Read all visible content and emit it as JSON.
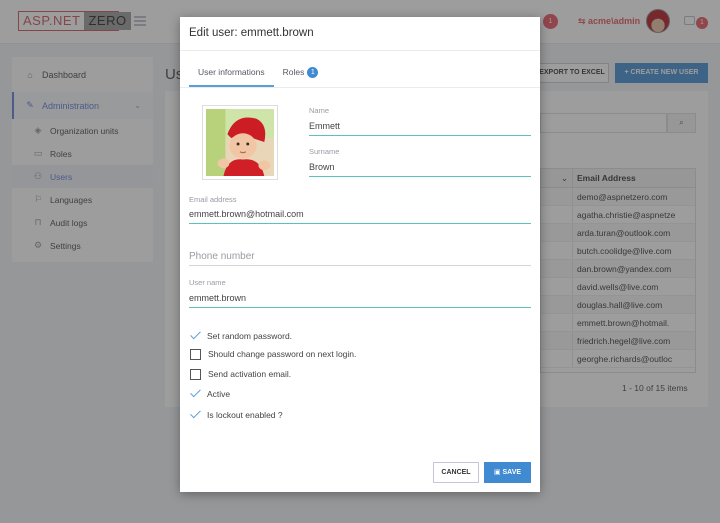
{
  "topbar": {
    "logo_part1": "ASP.NET",
    "logo_part2": "ZERO",
    "notification_count": "1",
    "user_label": "acme\\admin",
    "chat_count": "1"
  },
  "sidebar": {
    "items": [
      {
        "label": "Dashboard",
        "icon": "home-icon"
      },
      {
        "label": "Administration",
        "icon": "wrench-icon"
      },
      {
        "label": "Organization units",
        "icon": "layers-icon"
      },
      {
        "label": "Roles",
        "icon": "briefcase-icon"
      },
      {
        "label": "Users",
        "icon": "users-icon"
      },
      {
        "label": "Languages",
        "icon": "flag-icon"
      },
      {
        "label": "Audit logs",
        "icon": "lock-icon"
      },
      {
        "label": "Settings",
        "icon": "gear-icon"
      }
    ]
  },
  "page": {
    "title": "Us",
    "export_label": "EXPORT TO EXCEL",
    "create_label": "+ CREATE NEW USER",
    "table_header": "Email Address",
    "emails": [
      "demo@aspnetzero.com",
      "agatha.christie@aspnetze",
      "arda.turan@outlook.com",
      "butch.coolidge@live.com",
      "dan.brown@yandex.com",
      "david.wells@live.com",
      "douglas.hall@live.com",
      "emmett.brown@hotmail.",
      "friedrich.hegel@live.com",
      "georghe.richards@outloc"
    ],
    "pager_info": "1 - 10 of 15 items"
  },
  "modal": {
    "title": "Edit user: emmett.brown",
    "tabs": [
      {
        "label": "User informations"
      },
      {
        "label": "Roles",
        "badge": "1"
      }
    ],
    "fields": {
      "name_label": "Name",
      "name_value": "Emmett",
      "surname_label": "Surname",
      "surname_value": "Brown",
      "email_label": "Email address",
      "email_value": "emmett.brown@hotmail.com",
      "phone_placeholder": "Phone number",
      "username_label": "User name",
      "username_value": "emmett.brown"
    },
    "checks": [
      {
        "label": "Set random password.",
        "checked": true
      },
      {
        "label": "Should change password on next login.",
        "checked": false
      },
      {
        "label": "Send activation email.",
        "checked": false
      },
      {
        "label": "Active",
        "checked": true
      },
      {
        "label": "Is lockout enabled ?",
        "checked": true
      }
    ],
    "cancel_label": "CANCEL",
    "save_label": "SAVE"
  },
  "colors": {
    "accent_blue": "#3f8ad0",
    "input_underline": "#5bc0be",
    "badge_red": "#e7505a"
  }
}
